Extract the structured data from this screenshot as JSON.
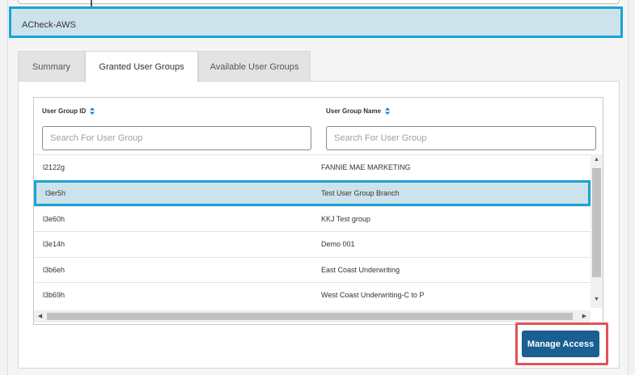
{
  "selected_application": {
    "name": "ACheck-AWS"
  },
  "tabs": [
    {
      "label": "Summary"
    },
    {
      "label": "Granted User Groups"
    },
    {
      "label": "Available User Groups"
    }
  ],
  "active_tab": "Granted User Groups",
  "grid": {
    "columns": [
      {
        "label": "User Group ID"
      },
      {
        "label": "User Group Name"
      }
    ],
    "search_placeholders": [
      "Search For User Group",
      "Search For User Group"
    ],
    "rows": [
      {
        "id": "l2122g",
        "name": "FANNIE MAE MARKETING"
      },
      {
        "id": "l3er5h",
        "name": "Test User Group Branch"
      },
      {
        "id": "l3e60h",
        "name": "KKJ Test group"
      },
      {
        "id": "l3e14h",
        "name": "Demo 001"
      },
      {
        "id": "l3b6eh",
        "name": "East Coast Underwriting"
      },
      {
        "id": "l3b69h",
        "name": "West Coast Underwriting-C to P"
      }
    ],
    "selected_row_id": "l3er5h"
  },
  "actions": {
    "manage_access_label": "Manage Access"
  },
  "colors": {
    "selection_fill": "#cde3eb",
    "selection_border": "#1aa3d6",
    "primary_button": "#1a5f92",
    "callout_highlight": "#e05555"
  },
  "icons": {
    "sort": "sort-updown-icon",
    "cursor": "text-cursor-icon"
  }
}
